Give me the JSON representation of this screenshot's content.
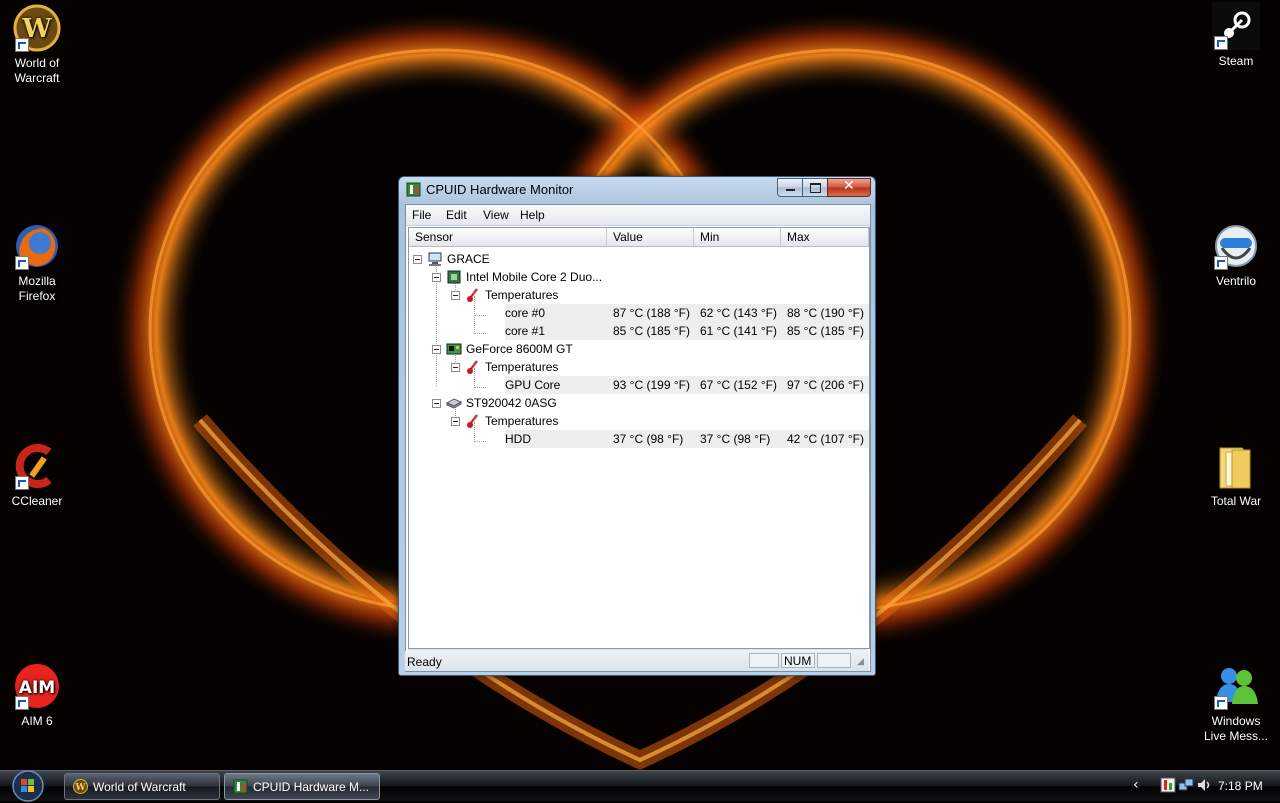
{
  "desktop": {
    "icons": [
      {
        "label": "World of\nWarcraft"
      },
      {
        "label": "Mozilla\nFirefox"
      },
      {
        "label": "CCleaner"
      },
      {
        "label": "AIM 6"
      },
      {
        "label": "Steam"
      },
      {
        "label": "Ventrilo"
      },
      {
        "label": "Total War"
      },
      {
        "label": "Windows\nLive Mess..."
      }
    ]
  },
  "window": {
    "title": "CPUID Hardware Monitor",
    "menu": [
      "File",
      "Edit",
      "View",
      "Help"
    ],
    "columns": [
      "Sensor",
      "Value",
      "Min",
      "Max"
    ],
    "tree": [
      {
        "label": "GRACE",
        "icon": "computer-icon",
        "level": 0
      },
      {
        "label": "Intel Mobile Core 2 Duo...",
        "icon": "cpu-icon",
        "level": 1
      },
      {
        "label": "Temperatures",
        "icon": "thermometer-icon",
        "level": 2
      },
      {
        "label": "core #0",
        "level": 3,
        "value": "87 °C  (188 °F)",
        "min": "62 °C  (143 °F)",
        "max": "88 °C  (190 °F)"
      },
      {
        "label": "core #1",
        "level": 3,
        "value": "85 °C  (185 °F)",
        "min": "61 °C  (141 °F)",
        "max": "85 °C  (185 °F)"
      },
      {
        "label": "GeForce 8600M GT",
        "icon": "gpu-icon",
        "level": 1
      },
      {
        "label": "Temperatures",
        "icon": "thermometer-icon",
        "level": 2
      },
      {
        "label": "GPU Core",
        "level": 3,
        "value": "93 °C  (199 °F)",
        "min": "67 °C  (152 °F)",
        "max": "97 °C  (206 °F)"
      },
      {
        "label": "ST920042 0ASG",
        "icon": "hdd-icon",
        "level": 1
      },
      {
        "label": "Temperatures",
        "icon": "thermometer-icon",
        "level": 2
      },
      {
        "label": "HDD",
        "level": 3,
        "value": "37 °C  (98 °F)",
        "min": "37 °C  (98 °F)",
        "max": "42 °C  (107 °F)"
      }
    ],
    "status": "Ready",
    "status_panels": [
      "",
      "NUM",
      ""
    ]
  },
  "taskbar": {
    "buttons": [
      {
        "label": "World of Warcraft"
      },
      {
        "label": "CPUID Hardware M..."
      }
    ],
    "clock": "7:18 PM"
  },
  "colors": {
    "accent_fire": "#ff7a10",
    "window_frame": "#b9cfe6",
    "value_bg": "#eeeeee"
  }
}
